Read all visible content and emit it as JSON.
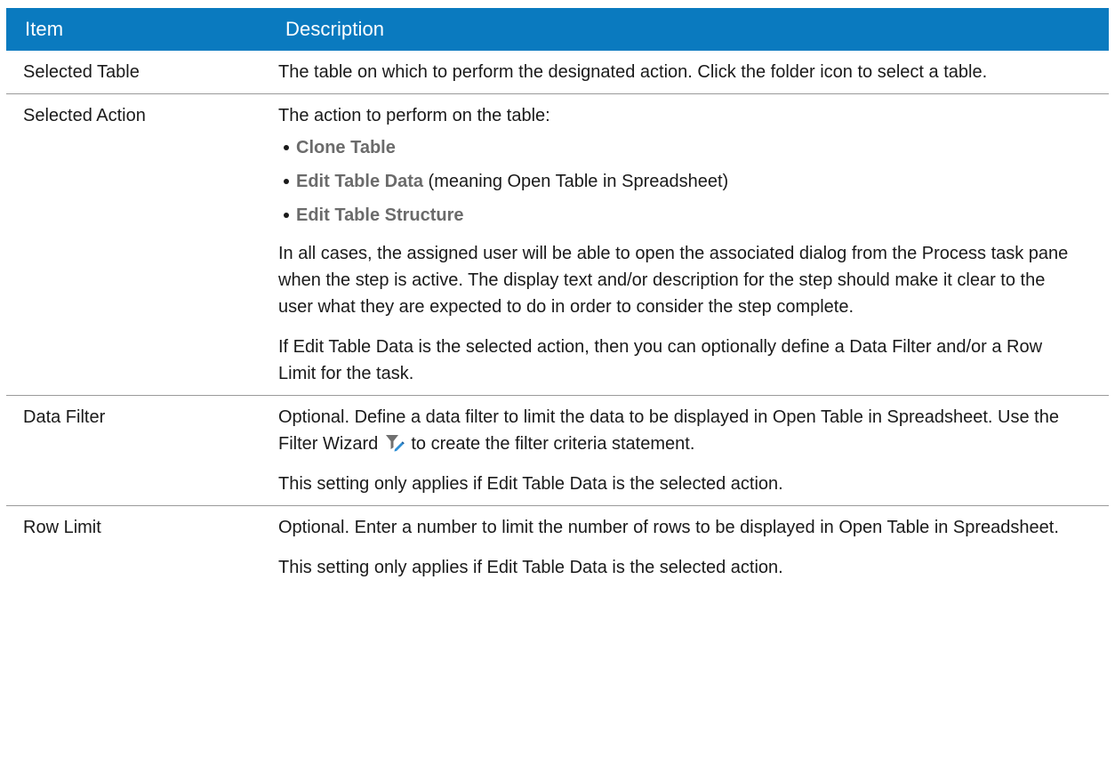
{
  "table": {
    "header": {
      "item": "Item",
      "description": "Description"
    },
    "rows": [
      {
        "item": "Selected Table",
        "paragraphs": [
          "The table on which to perform the designated action. Click the folder icon to select a table."
        ]
      },
      {
        "item": "Selected Action",
        "intro": "The action to perform on the table:",
        "actions": [
          {
            "name": "Clone Table",
            "suffix": ""
          },
          {
            "name": "Edit Table Data",
            "suffix": " (meaning Open Table in Spreadsheet)"
          },
          {
            "name": "Edit Table Structure",
            "suffix": ""
          }
        ],
        "paragraphs": [
          "In all cases, the assigned user will be able to open the associated dialog from the Process task pane when the step is active. The display text and/or description for the step should make it clear to the user what they are expected to do in order to consider the step complete.",
          "If Edit Table Data is the selected action, then you can optionally define a Data Filter and/or a Row Limit for the task."
        ]
      },
      {
        "item": "Data Filter",
        "para1_before": "Optional. Define a data filter to limit the data to be displayed in Open Table in Spreadsheet. Use the Filter Wizard ",
        "para1_icon": "filter-wizard-icon",
        "para1_after": " to create the filter criteria statement.",
        "paragraphs": [
          "This setting only applies if Edit Table Data is the selected action."
        ]
      },
      {
        "item": "Row Limit",
        "paragraphs": [
          "Optional. Enter a number to limit the number of rows to be displayed in Open Table in Spreadsheet.",
          "This setting only applies if Edit Table Data is the selected action."
        ]
      }
    ]
  },
  "colors": {
    "header_bg": "#0a7abf",
    "header_text": "#ffffff",
    "action_name": "#6b6b6b",
    "row_divider": "#9a9a9a"
  }
}
